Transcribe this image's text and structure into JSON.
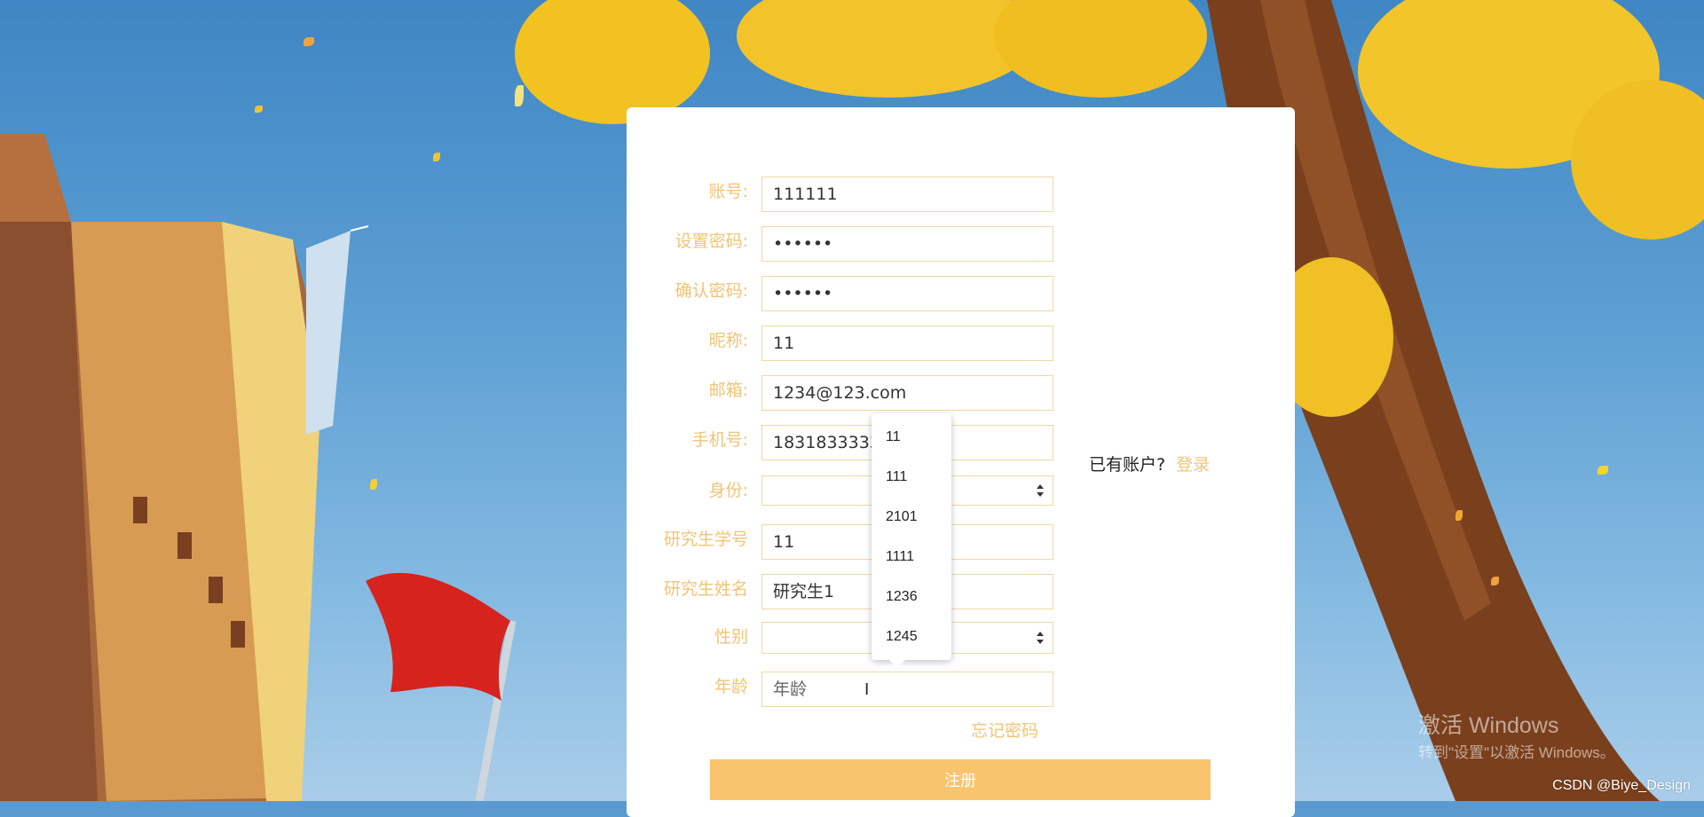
{
  "form": {
    "fields": [
      {
        "label": "账号:",
        "value": "111111"
      },
      {
        "label": "设置密码:",
        "value": "••••••"
      },
      {
        "label": "确认密码:",
        "value": "••••••"
      },
      {
        "label": "昵称:",
        "value": "11"
      },
      {
        "label": "邮箱:",
        "value": "1234@123.com"
      },
      {
        "label": "手机号:",
        "value": "1831833333"
      },
      {
        "label": "身份:",
        "value": ""
      },
      {
        "label": "研究生学号",
        "value": "11"
      },
      {
        "label": "研究生姓名",
        "value": "研究生1"
      },
      {
        "label": "性别",
        "value": ""
      },
      {
        "label": "年龄",
        "placeholder": "年龄"
      }
    ],
    "login_hint": "已有账户?",
    "login_link": "登录",
    "forgot_password": "忘记密码",
    "submit_label": "注册"
  },
  "autocomplete": {
    "options": [
      "11",
      "111",
      "2101",
      "1111",
      "1236",
      "1245"
    ]
  },
  "overlay": {
    "windows_activate_title": "激活 Windows",
    "windows_activate_sub": "转到\"设置\"以激活 Windows。",
    "csdn_watermark": "CSDN @Biye_Design"
  },
  "colors": {
    "accent": "#f0c476",
    "button": "#f8c46e",
    "field_border": "#f0d9a2"
  },
  "icons": [
    "select-updown-icon",
    "text-cursor-icon"
  ]
}
